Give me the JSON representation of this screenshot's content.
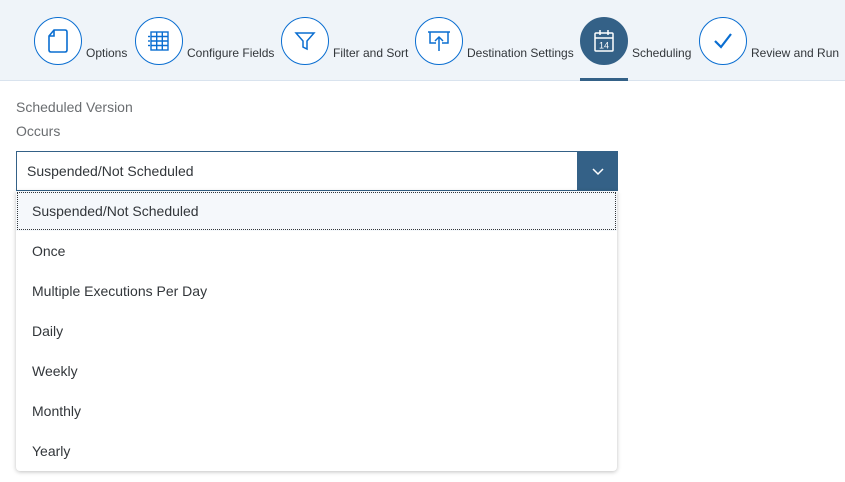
{
  "wizard": {
    "steps": [
      {
        "label": "Options",
        "icon": "document-icon"
      },
      {
        "label": "Configure Fields",
        "icon": "table-grid-icon"
      },
      {
        "label": "Filter and Sort",
        "icon": "filter-icon"
      },
      {
        "label": "Destination Settings",
        "icon": "presentation-upload-icon"
      },
      {
        "label": "Scheduling",
        "icon": "calendar-icon",
        "calendar_day": "14",
        "active": true
      },
      {
        "label": "Review and Run",
        "icon": "checkmark-icon"
      }
    ]
  },
  "form": {
    "scheduled_version_label": "Scheduled Version",
    "occurs_label": "Occurs",
    "occurs_value": "Suspended/Not Scheduled",
    "options": [
      "Suspended/Not Scheduled",
      "Once",
      "Multiple Executions Per Day",
      "Daily",
      "Weekly",
      "Monthly",
      "Yearly"
    ]
  },
  "colors": {
    "accent": "#0a6ed1",
    "active": "#346187",
    "header_bg": "#eff4f9"
  }
}
